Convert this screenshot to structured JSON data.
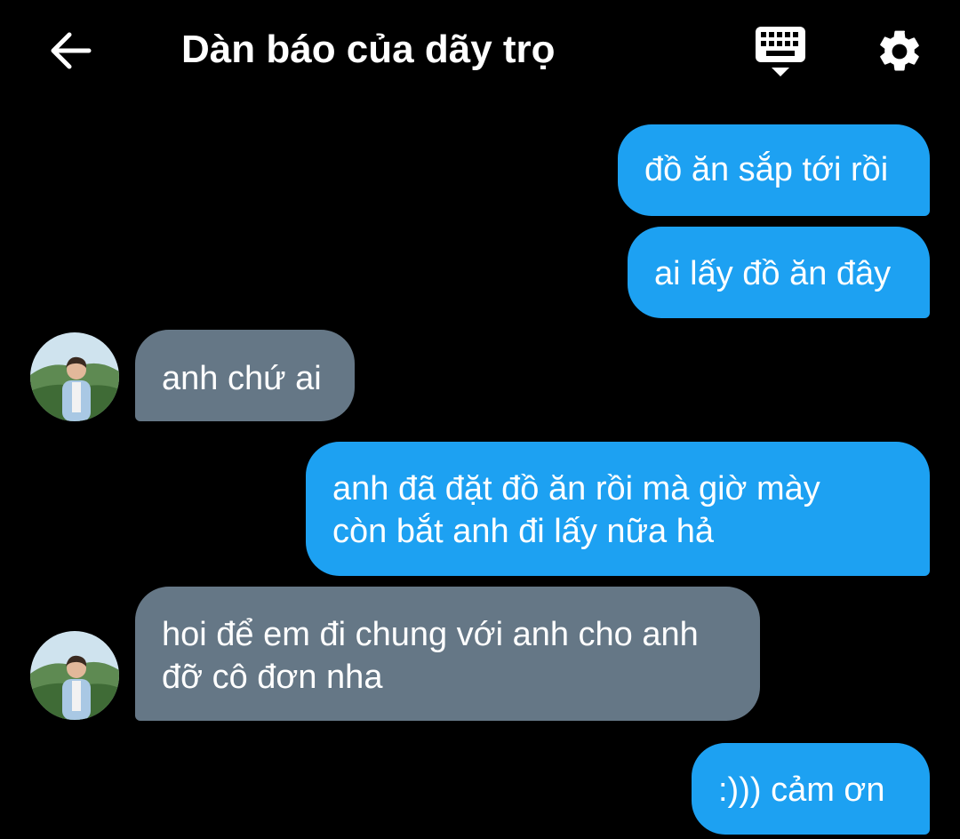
{
  "header": {
    "title": "Dàn báo của dãy trọ",
    "back_icon": "arrow-left-icon",
    "keyboard_icon": "keyboard-icon",
    "settings_icon": "gear-icon"
  },
  "colors": {
    "background": "#000000",
    "sent_bubble": "#1da1f2",
    "received_bubble": "#657786",
    "text": "#ffffff"
  },
  "messages": [
    {
      "direction": "sent",
      "lines": [
        "đồ ăn sắp tới rồi"
      ]
    },
    {
      "direction": "sent",
      "lines": [
        "ai lấy đồ ăn đây"
      ]
    },
    {
      "direction": "received",
      "lines": [
        "anh chứ ai"
      ]
    },
    {
      "direction": "sent",
      "lines": [
        "anh đã đặt đồ ăn rồi mà giờ mày",
        "còn bắt anh đi lấy nữa hả"
      ]
    },
    {
      "direction": "received",
      "lines": [
        "hoi để em đi chung với anh cho anh",
        "đỡ cô đơn nha"
      ]
    },
    {
      "direction": "sent",
      "lines": [
        ":))) cảm ơn"
      ]
    }
  ]
}
